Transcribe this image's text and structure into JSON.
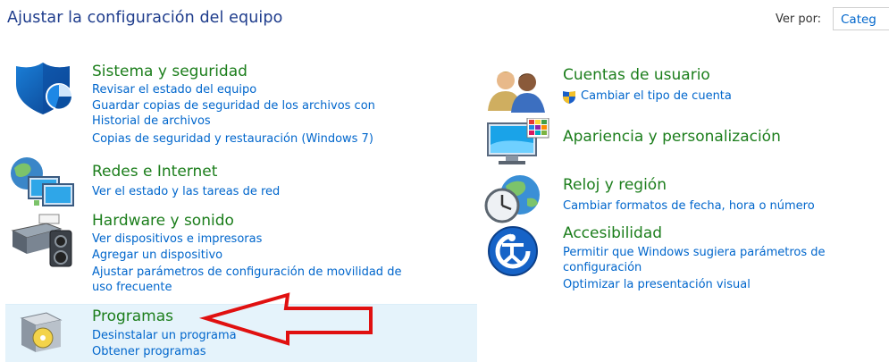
{
  "header": {
    "title": "Ajustar la configuración del equipo",
    "view_by_label": "Ver por:",
    "view_by_value": "Categ"
  },
  "left": {
    "system": {
      "title": "Sistema y seguridad",
      "links": [
        "Revisar el estado del equipo",
        "Guardar copias de seguridad de los archivos con",
        "Historial de archivos",
        "Copias de seguridad y restauración (Windows 7)"
      ]
    },
    "network": {
      "title": "Redes e Internet",
      "links": [
        "Ver el estado y las tareas de red"
      ]
    },
    "hardware": {
      "title": "Hardware y sonido",
      "links": [
        "Ver dispositivos e impresoras",
        "Agregar un dispositivo",
        "Ajustar parámetros de configuración de movilidad de",
        "uso frecuente"
      ]
    },
    "programs": {
      "title": "Programas",
      "links": [
        "Desinstalar un programa",
        "Obtener programas"
      ]
    }
  },
  "right": {
    "accounts": {
      "title": "Cuentas de usuario",
      "links": [
        "Cambiar el tipo de cuenta"
      ]
    },
    "appearance": {
      "title": "Apariencia y personalización"
    },
    "clock": {
      "title": "Reloj y región",
      "links": [
        "Cambiar formatos de fecha, hora o número"
      ]
    },
    "access": {
      "title": "Accesibilidad",
      "links": [
        "Permitir que Windows sugiera parámetros de",
        "configuración",
        "Optimizar la presentación visual"
      ]
    }
  },
  "colors": {
    "category_title": "#1c7e1c",
    "link": "#0066cc",
    "highlight_bg": "#e5f3fb",
    "annotation_arrow": "#e01010"
  }
}
